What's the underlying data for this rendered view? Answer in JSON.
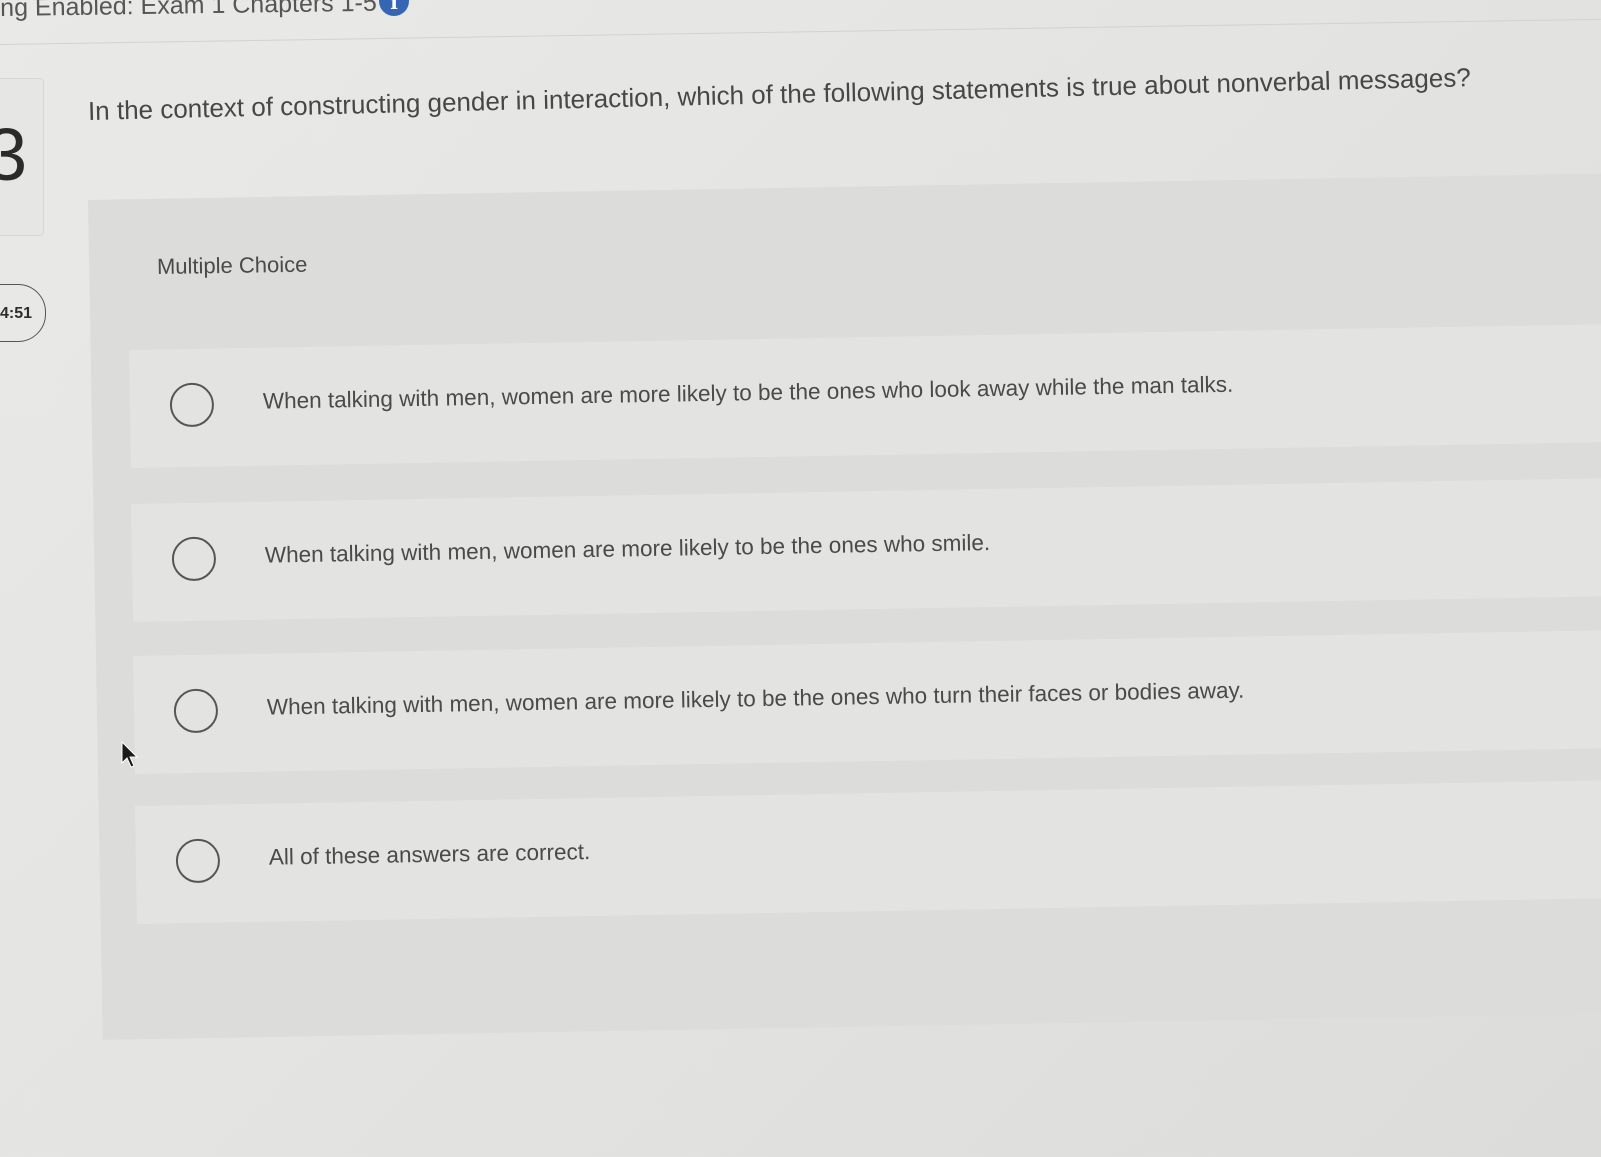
{
  "header": {
    "title": "ng Enabled: Exam 1 Chapters 1-5",
    "info_icon": "info-icon"
  },
  "sidebar": {
    "question_number": "3",
    "timer": "4:51"
  },
  "question": {
    "text": "In the context of constructing gender in interaction, which of the following statements is true about nonverbal messages?",
    "type_label": "Multiple Choice"
  },
  "options": [
    {
      "label": "When talking with men, women are more likely to be the ones who look away while the man talks."
    },
    {
      "label": "When talking with men, women are more likely to be the ones who smile."
    },
    {
      "label": "When talking with men, women are more likely to be the ones who turn their faces or bodies away."
    },
    {
      "label": "All of these answers are correct."
    }
  ],
  "colors": {
    "accent": "#3566b4",
    "background": "#e6e6e4",
    "text": "#4a4a4a"
  }
}
